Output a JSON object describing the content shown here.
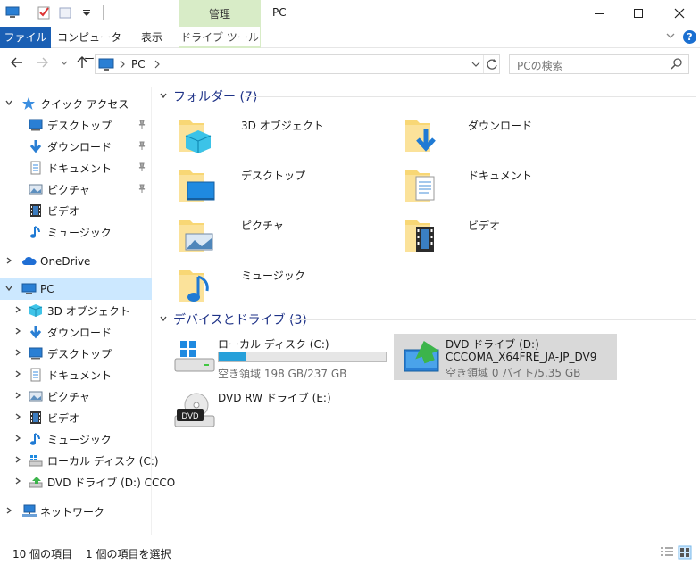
{
  "title_bar": {
    "manage_tab": "管理",
    "window_title": "PC"
  },
  "ribbon": {
    "tabs": [
      "ファイル",
      "コンピューター",
      "表示"
    ],
    "contextual_tab": "ドライブ ツール",
    "help": "?"
  },
  "address": {
    "crumb": "PC",
    "search_placeholder": "PCの検索"
  },
  "nav": {
    "quick_access": {
      "label": "クイック アクセス",
      "items": [
        {
          "label": "デスクトップ",
          "icon": "desktop-icon"
        },
        {
          "label": "ダウンロード",
          "icon": "download-icon"
        },
        {
          "label": "ドキュメント",
          "icon": "document-icon"
        },
        {
          "label": "ピクチャ",
          "icon": "picture-icon"
        },
        {
          "label": "ビデオ",
          "icon": "video-icon"
        },
        {
          "label": "ミュージック",
          "icon": "music-icon"
        }
      ]
    },
    "onedrive": "OneDrive",
    "pc": {
      "label": "PC",
      "items": [
        {
          "label": "3D オブジェクト",
          "icon": "3d-objects-icon"
        },
        {
          "label": "ダウンロード",
          "icon": "download-icon"
        },
        {
          "label": "デスクトップ",
          "icon": "desktop-icon"
        },
        {
          "label": "ドキュメント",
          "icon": "document-icon"
        },
        {
          "label": "ピクチャ",
          "icon": "picture-icon"
        },
        {
          "label": "ビデオ",
          "icon": "video-icon"
        },
        {
          "label": "ミュージック",
          "icon": "music-icon"
        },
        {
          "label": "ローカル ディスク (C:)",
          "icon": "local-disk-icon"
        },
        {
          "label": "DVD ドライブ (D:) CCCO",
          "icon": "dvd-drive-icon"
        }
      ]
    },
    "network": "ネットワーク"
  },
  "content": {
    "folders_header": "フォルダー (7)",
    "folders": [
      {
        "name": "3D オブジェクト",
        "icon": "3d-objects-folder-icon"
      },
      {
        "name": "ダウンロード",
        "icon": "downloads-folder-icon"
      },
      {
        "name": "デスクトップ",
        "icon": "desktop-folder-icon"
      },
      {
        "name": "ドキュメント",
        "icon": "documents-folder-icon"
      },
      {
        "name": "ピクチャ",
        "icon": "pictures-folder-icon"
      },
      {
        "name": "ビデオ",
        "icon": "videos-folder-icon"
      },
      {
        "name": "ミュージック",
        "icon": "music-folder-icon"
      }
    ],
    "devices_header": "デバイスとドライブ (3)",
    "drives": [
      {
        "name": "ローカル ディスク (C:)",
        "free": "空き領域 198 GB/237 GB",
        "used_fraction": 0.165
      },
      {
        "name": "DVD ドライブ (D:)",
        "volume": "CCCOMA_X64FRE_JA-JP_DV9",
        "free": "空き領域 0 バイト/5.35 GB"
      },
      {
        "name": "DVD RW ドライブ (E:)",
        "badge": "DVD"
      }
    ]
  },
  "status": {
    "item_count": "10 個の項目",
    "selection": "1 個の項目を選択"
  },
  "colors": {
    "accent": "#1a5fb4",
    "selection": "#cce8ff",
    "manage_green": "#d8ecc7",
    "bar_fill": "#26a0da",
    "folder_yellow": "#f8d775"
  }
}
